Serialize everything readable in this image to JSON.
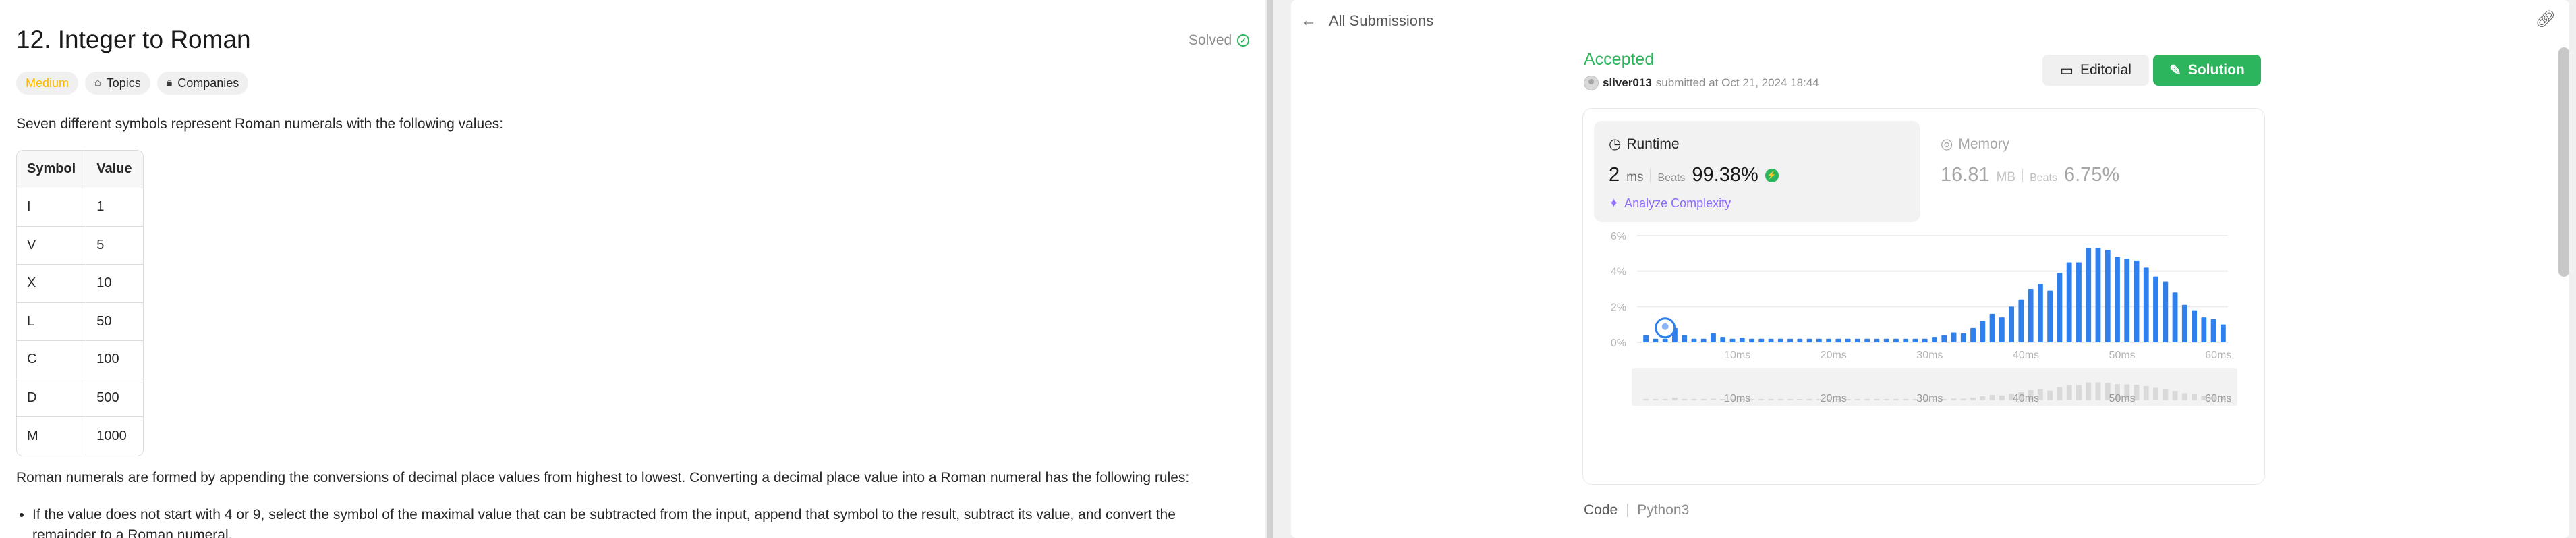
{
  "problem": {
    "title": "12. Integer to Roman",
    "status": "Solved",
    "difficulty": "Medium",
    "tags": [
      "Topics",
      "Companies"
    ],
    "intro": "Seven different symbols represent Roman numerals with the following values:",
    "table": {
      "headers": [
        "Symbol",
        "Value"
      ],
      "rows": [
        [
          "I",
          "1"
        ],
        [
          "V",
          "5"
        ],
        [
          "X",
          "10"
        ],
        [
          "L",
          "50"
        ],
        [
          "C",
          "100"
        ],
        [
          "D",
          "500"
        ],
        [
          "M",
          "1000"
        ]
      ]
    },
    "paragraph": "Roman numerals are formed by appending the conversions of decimal place values from highest to lowest. Converting a decimal place value into a Roman numeral has the following rules:",
    "bullets": [
      "If the value does not start with 4 or 9, select the symbol of the maximal value that can be subtracted from the input, append that symbol to the result, subtract its value, and convert the remainder to a Roman numeral."
    ]
  },
  "submission": {
    "back_label": "All Submissions",
    "result": "Accepted",
    "user": "sliver013",
    "submitted_text": "submitted at Oct 21, 2024 18:44",
    "editorial_label": "Editorial",
    "solution_label": "Solution",
    "runtime": {
      "label": "Runtime",
      "value": "2",
      "unit": "ms",
      "beats_label": "Beats",
      "beats": "99.38%"
    },
    "memory": {
      "label": "Memory",
      "value": "16.81",
      "unit": "MB",
      "beats_label": "Beats",
      "beats": "6.75%"
    },
    "analyze_label": "Analyze Complexity",
    "code_label": "Code",
    "language": "Python3"
  },
  "colors": {
    "accent_green": "#2db55d",
    "bar_blue": "#2f80ed",
    "medium": "#ffb800",
    "analyze": "#8d6bff"
  },
  "chart_data": {
    "type": "bar",
    "x_ticks": [
      "10ms",
      "20ms",
      "30ms",
      "40ms",
      "50ms",
      "60ms"
    ],
    "y_ticks": [
      "0%",
      "2%",
      "4%",
      "6%"
    ],
    "ylim": [
      0,
      6
    ],
    "xlim": [
      0,
      61
    ],
    "grid": true,
    "marker_x": 2,
    "series": [
      {
        "values": [
          [
            0,
            0.4
          ],
          [
            1,
            0.2
          ],
          [
            2,
            0.2
          ],
          [
            3,
            0.8
          ],
          [
            4,
            0.4
          ],
          [
            5,
            0.2
          ],
          [
            6,
            0.2
          ],
          [
            7,
            0.5
          ],
          [
            8,
            0.3
          ],
          [
            9,
            0.2
          ],
          [
            10,
            0.25
          ],
          [
            11,
            0.2
          ],
          [
            12,
            0.2
          ],
          [
            13,
            0.2
          ],
          [
            14,
            0.2
          ],
          [
            15,
            0.2
          ],
          [
            16,
            0.2
          ],
          [
            17,
            0.2
          ],
          [
            18,
            0.2
          ],
          [
            19,
            0.2
          ],
          [
            20,
            0.2
          ],
          [
            21,
            0.2
          ],
          [
            22,
            0.2
          ],
          [
            23,
            0.2
          ],
          [
            24,
            0.2
          ],
          [
            25,
            0.2
          ],
          [
            26,
            0.2
          ],
          [
            27,
            0.2
          ],
          [
            28,
            0.2
          ],
          [
            29,
            0.2
          ],
          [
            30,
            0.3
          ],
          [
            31,
            0.4
          ],
          [
            32,
            0.55
          ],
          [
            33,
            0.5
          ],
          [
            34,
            0.8
          ],
          [
            35,
            1.2
          ],
          [
            36,
            1.6
          ],
          [
            37,
            1.4
          ],
          [
            38,
            2.0
          ],
          [
            39,
            2.4
          ],
          [
            40,
            3.0
          ],
          [
            41,
            3.3
          ],
          [
            42,
            2.9
          ],
          [
            43,
            3.9
          ],
          [
            44,
            4.5
          ],
          [
            45,
            4.5
          ],
          [
            46,
            5.3
          ],
          [
            47,
            5.3
          ],
          [
            48,
            5.2
          ],
          [
            49,
            4.8
          ],
          [
            50,
            4.7
          ],
          [
            51,
            4.6
          ],
          [
            52,
            4.2
          ],
          [
            53,
            3.7
          ],
          [
            54,
            3.4
          ],
          [
            55,
            2.8
          ],
          [
            56,
            2.1
          ],
          [
            57,
            1.8
          ],
          [
            58,
            1.4
          ],
          [
            59,
            1.3
          ],
          [
            60,
            1.0
          ]
        ]
      }
    ]
  }
}
